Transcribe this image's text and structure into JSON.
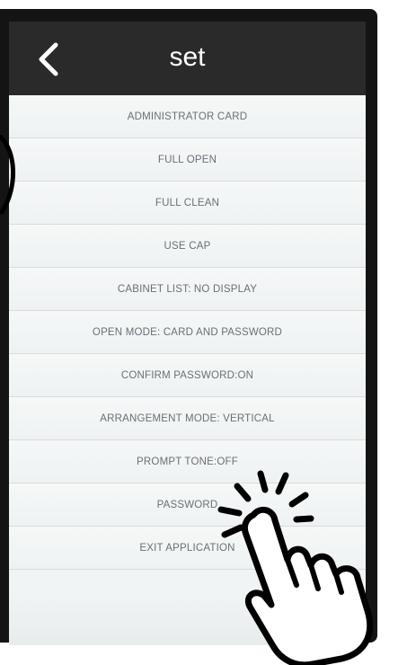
{
  "header": {
    "title": "set",
    "back_icon": "chevron-left-icon"
  },
  "menu": {
    "items": [
      {
        "label": "ADMINISTRATOR CARD"
      },
      {
        "label": "FULL OPEN"
      },
      {
        "label": "FULL CLEAN"
      },
      {
        "label": "USE CAP"
      },
      {
        "label": "CABINET LIST:  NO DISPLAY"
      },
      {
        "label": "OPEN MODE:  CARD AND PASSWORD"
      },
      {
        "label": "CONFIRM PASSWORD:ON"
      },
      {
        "label": "ARRANGEMENT MODE:  VERTICAL"
      },
      {
        "label": "PROMPT TONE:OFF"
      },
      {
        "label": "PASSWORD"
      },
      {
        "label": "EXIT APPLICATION"
      }
    ]
  },
  "colors": {
    "header_bg": "#2a2a2a",
    "list_bg": "#f1f4f4",
    "item_text": "#6b6f74",
    "divider": "#d7dcdd"
  },
  "overlay": {
    "hand_icon": "tap-hand-icon"
  }
}
